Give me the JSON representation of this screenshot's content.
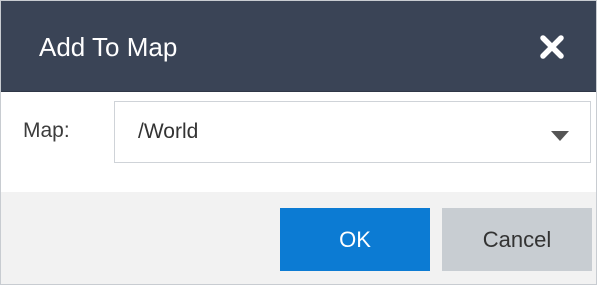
{
  "dialog": {
    "title": "Add To Map",
    "close_icon": "close-icon"
  },
  "form": {
    "map_label": "Map:",
    "map_value": "/World",
    "dropdown_icon": "caret-down-icon"
  },
  "footer": {
    "ok_label": "OK",
    "cancel_label": "Cancel"
  },
  "colors": {
    "title_bar": "#3a4456",
    "primary_button": "#0c7bd3",
    "secondary_button": "#c8cdd2",
    "footer_background": "#f2f2f2"
  }
}
